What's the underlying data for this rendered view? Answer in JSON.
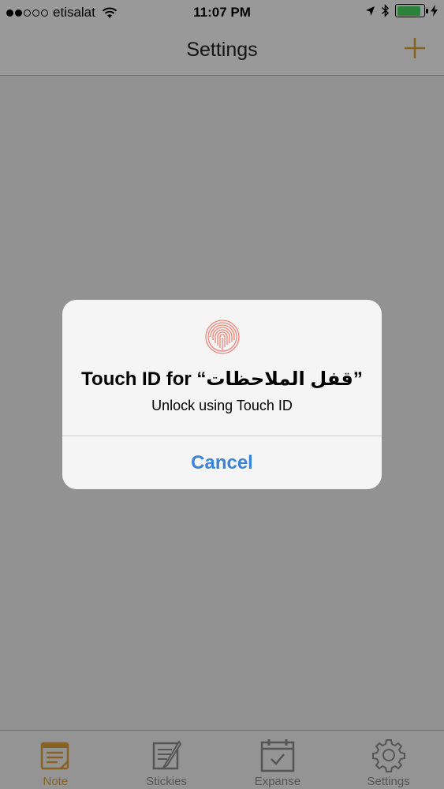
{
  "status_bar": {
    "carrier": "etisalat",
    "time": "11:07 PM",
    "signal_bars": 2,
    "signal_total": 5,
    "battery_level": 0.9,
    "battery_color": "#4cd964"
  },
  "nav": {
    "title": "Settings",
    "add_icon": "plus-icon",
    "accent_color": "#e4a33a"
  },
  "alert": {
    "icon": "fingerprint-icon",
    "title": "Touch ID for “قفل الملاحظات”",
    "message": "Unlock using Touch ID",
    "cancel_label": "Cancel",
    "cancel_color": "#3a83d9"
  },
  "tabs": [
    {
      "label": "Note",
      "icon": "note-icon",
      "active": true
    },
    {
      "label": "Stickies",
      "icon": "stickies-icon",
      "active": false
    },
    {
      "label": "Expanse",
      "icon": "calendar-icon",
      "active": false
    },
    {
      "label": "Settings",
      "icon": "gear-icon",
      "active": false
    }
  ]
}
